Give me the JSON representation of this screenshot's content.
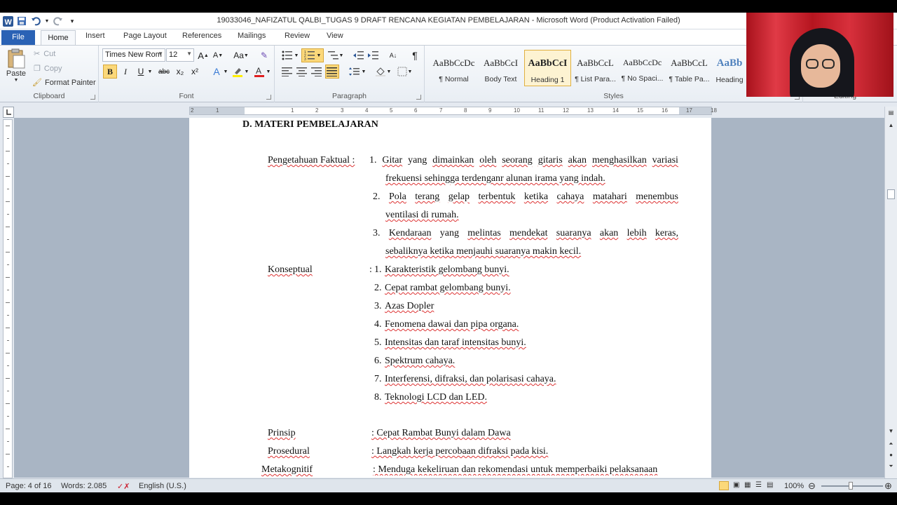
{
  "window": {
    "title": "19033046_NAFIZATUL QALBI_TUGAS 9 DRAFT RENCANA KEGIATAN PEMBELAJARAN  -  Microsoft Word (Product Activation Failed)"
  },
  "tabs": [
    "File",
    "Home",
    "Insert",
    "Page Layout",
    "References",
    "Mailings",
    "Review",
    "View"
  ],
  "clipboard": {
    "paste": "Paste",
    "cut": "Cut",
    "copy": "Copy",
    "format_painter": "Format Painter",
    "label": "Clipboard"
  },
  "font": {
    "name": "Times New Rom",
    "size": "12",
    "label": "Font",
    "case_btn": "Aa",
    "grow": "A",
    "shrink": "A",
    "bold": "B",
    "italic": "I",
    "underline": "U",
    "strike": "abc",
    "subscript": "x₂",
    "superscript": "x²"
  },
  "paragraph": {
    "label": "Paragraph",
    "pilcrow": "¶"
  },
  "styles": {
    "label": "Styles",
    "items": [
      {
        "sample": "AaBbCcDc",
        "name": "¶ Normal"
      },
      {
        "sample": "AaBbCcI",
        "name": "Body Text"
      },
      {
        "sample": "AaBbCcI",
        "name": "Heading 1"
      },
      {
        "sample": "AaBbCcL",
        "name": "¶ List Para..."
      },
      {
        "sample": "AaBbCcDc",
        "name": "¶ No Spaci..."
      },
      {
        "sample": "AaBbCcL",
        "name": "¶ Table Pa..."
      },
      {
        "sample": "AaBb",
        "name": "Heading"
      }
    ]
  },
  "editing": {
    "label": "Editing"
  },
  "ruler": {
    "numbers": [
      "2",
      "1",
      "1",
      "2",
      "3",
      "4",
      "5",
      "6",
      "7",
      "8",
      "9",
      "10",
      "11",
      "12",
      "13",
      "14",
      "15",
      "16",
      "17",
      "18"
    ]
  },
  "document": {
    "heading": "D. MATERI PEMBELAJARAN",
    "faktual": {
      "label": "Pengetahuan Faktual :",
      "items": [
        [
          "1.",
          "Gitar",
          "yang",
          "dimainkan",
          "oleh",
          "seorang",
          "gitaris",
          "akan",
          "menghasilkan",
          "variasi"
        ],
        "frekuensi sehingga terdenganr alunan irama yang indah.",
        [
          "2.",
          "Pola",
          "terang",
          "gelap",
          "terbentuk",
          "ketika",
          "cahaya",
          "matahari",
          "menembus"
        ],
        "ventilasi di rumah.",
        [
          "3.",
          "Kendaraan",
          "yang",
          "melintas",
          "mendekat",
          "suaranya",
          "akan",
          "lebih",
          "keras,"
        ],
        "sebaliknya ketika menjauhi suaranya makin kecil."
      ]
    },
    "konseptual": {
      "label": "Konseptual",
      "colon": ":",
      "items": [
        {
          "num": "1.",
          "text": "Karakteristik gelombang bunyi."
        },
        {
          "num": "2.",
          "text": "Cepat rambat gelombang bunyi."
        },
        {
          "num": "3.",
          "text": "Azas Dopler"
        },
        {
          "num": "4.",
          "text": "Fenomena dawai dan pipa organa."
        },
        {
          "num": "5.",
          "text": "Intensitas dan taraf intensitas bunyi."
        },
        {
          "num": "6.",
          "text": "Spektrum cahaya."
        },
        {
          "num": "7.",
          "text": "Interferensi, difraksi, dan polarisasi cahaya."
        },
        {
          "num": "8.",
          "text": "Teknologi  LCD dan LED."
        }
      ]
    },
    "prinsip": {
      "label": "Prinsip",
      "value": ": Cepat Rambat Bunyi dalam Dawa"
    },
    "prosedural": {
      "label": "Prosedural",
      "value": ": Langkah kerja percobaan difraksi pada kisi."
    },
    "metakognitif": {
      "label": "Metakognitif",
      "value": ": Menduga kekeliruan dan rekomendasi untuk memperbaiki pelaksanaan"
    }
  },
  "status": {
    "page": "Page: 4 of 16",
    "words": "Words: 2.085",
    "language": "English (U.S.)",
    "zoom": "100%"
  }
}
